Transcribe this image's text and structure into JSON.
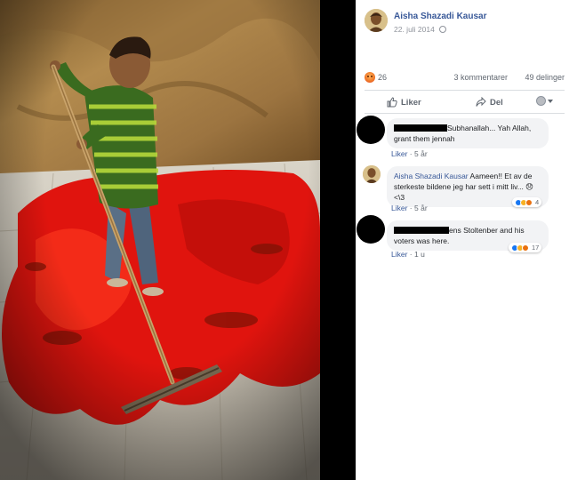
{
  "post": {
    "author": "Aisha Shazadi Kausar",
    "date": "22. juli 2014",
    "privacy_icon": "globe-icon"
  },
  "reactions": {
    "type": "angry",
    "count": "26",
    "comments": "3 kommentarer",
    "shares": "49 delinger"
  },
  "actions": {
    "like": "Liker",
    "share": "Del"
  },
  "comments": [
    {
      "author_redacted": true,
      "text": "Subhanallah... Yah Allah, grant them jennah",
      "like": "Liker",
      "age": "5 år"
    },
    {
      "author": "Aisha Shazadi Kausar",
      "text": "Aameen!! Et av de sterkeste bildene jeg har sett i mitt liv... 😞 <\\3",
      "like": "Liker",
      "age": "5 år",
      "reaction_count": "4"
    },
    {
      "author_redacted": true,
      "text_a": "ens Stoltenber and his",
      "text_b": "voters was here.",
      "like": "Liker",
      "age": "1 u",
      "reaction_count": "17"
    }
  ],
  "colors": {
    "link": "#385898",
    "meta": "#606770",
    "bubble": "#f2f3f5",
    "blood": "#e0140e"
  }
}
